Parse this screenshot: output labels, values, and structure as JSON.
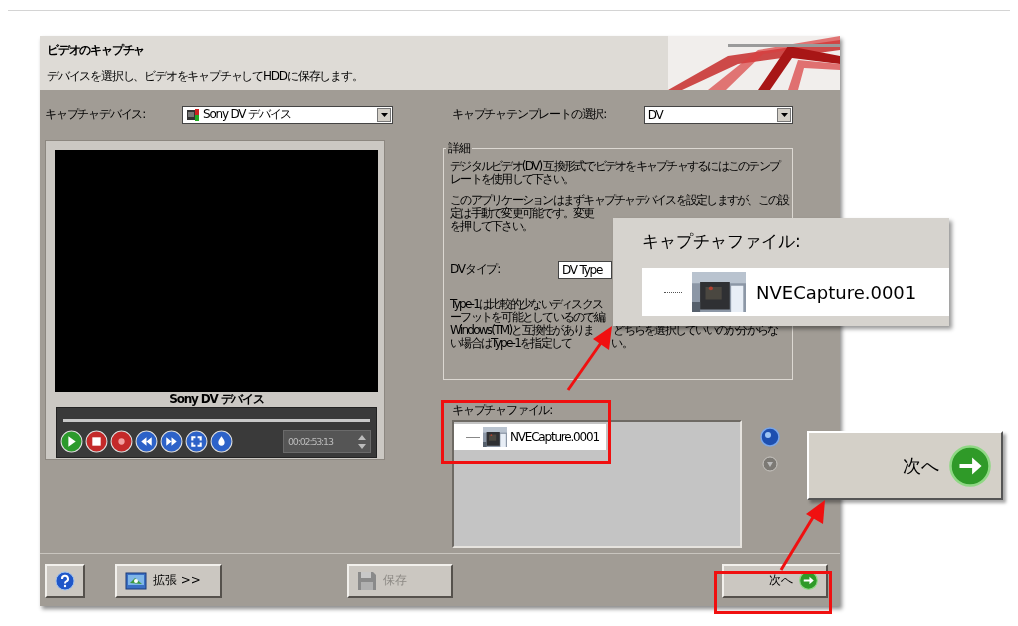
{
  "header": {
    "title": "ビデオのキャプチャ",
    "subtitle": "デバイスを選択し、ビデオをキャプチャしてHDDに保存します。"
  },
  "capture_device": {
    "label": "キャプチャデバイス:",
    "value": "Sony DV デバイス"
  },
  "preview": {
    "caption": "Sony DV デバイス",
    "timecode": "00:02:53:13"
  },
  "template": {
    "label": "キャプチャテンプレートの選択:",
    "value": "DV"
  },
  "details": {
    "legend": "詳細",
    "blocks": [
      {
        "kind": "text",
        "lines": [
          "デジタルビデオ(DV) 互換形式でビデオをキャプチャするにはこのテンプ",
          "レートを使用して下さい。"
        ]
      },
      {
        "kind": "text",
        "lines": [
          "このアプリケーションはまずキャプチャデバイスを設定しますが、この設",
          "定は手動で変更可能です。変更",
          "を押して下さい。"
        ]
      },
      {
        "kind": "dv_type",
        "label": "DVタイプ:",
        "value": "DV Type"
      },
      {
        "kind": "text",
        "lines": [
          "Type-1は比較的少ないディスクス",
          "ーフットを可能としているので編",
          [
            "Windows(TM)と互換性がありま",
            "どちらを選択していいのか分からな"
          ],
          [
            "い場合はType-1を指定して",
            "い。"
          ]
        ]
      }
    ]
  },
  "capture_files": {
    "label": "キャプチャファイル:",
    "items": [
      {
        "name": "NVECapture.0001"
      }
    ]
  },
  "buttons": [
    {
      "kind": "expand",
      "label": "拡張 >>",
      "disabled": false
    },
    {
      "kind": "save",
      "label": "保存",
      "disabled": true
    },
    {
      "kind": "next",
      "label": "次へ",
      "disabled": false
    }
  ],
  "callouts": {
    "file": {
      "label": "キャプチャファイル:",
      "name": "NVECapture.0001"
    },
    "next": {
      "label": "次へ"
    }
  }
}
